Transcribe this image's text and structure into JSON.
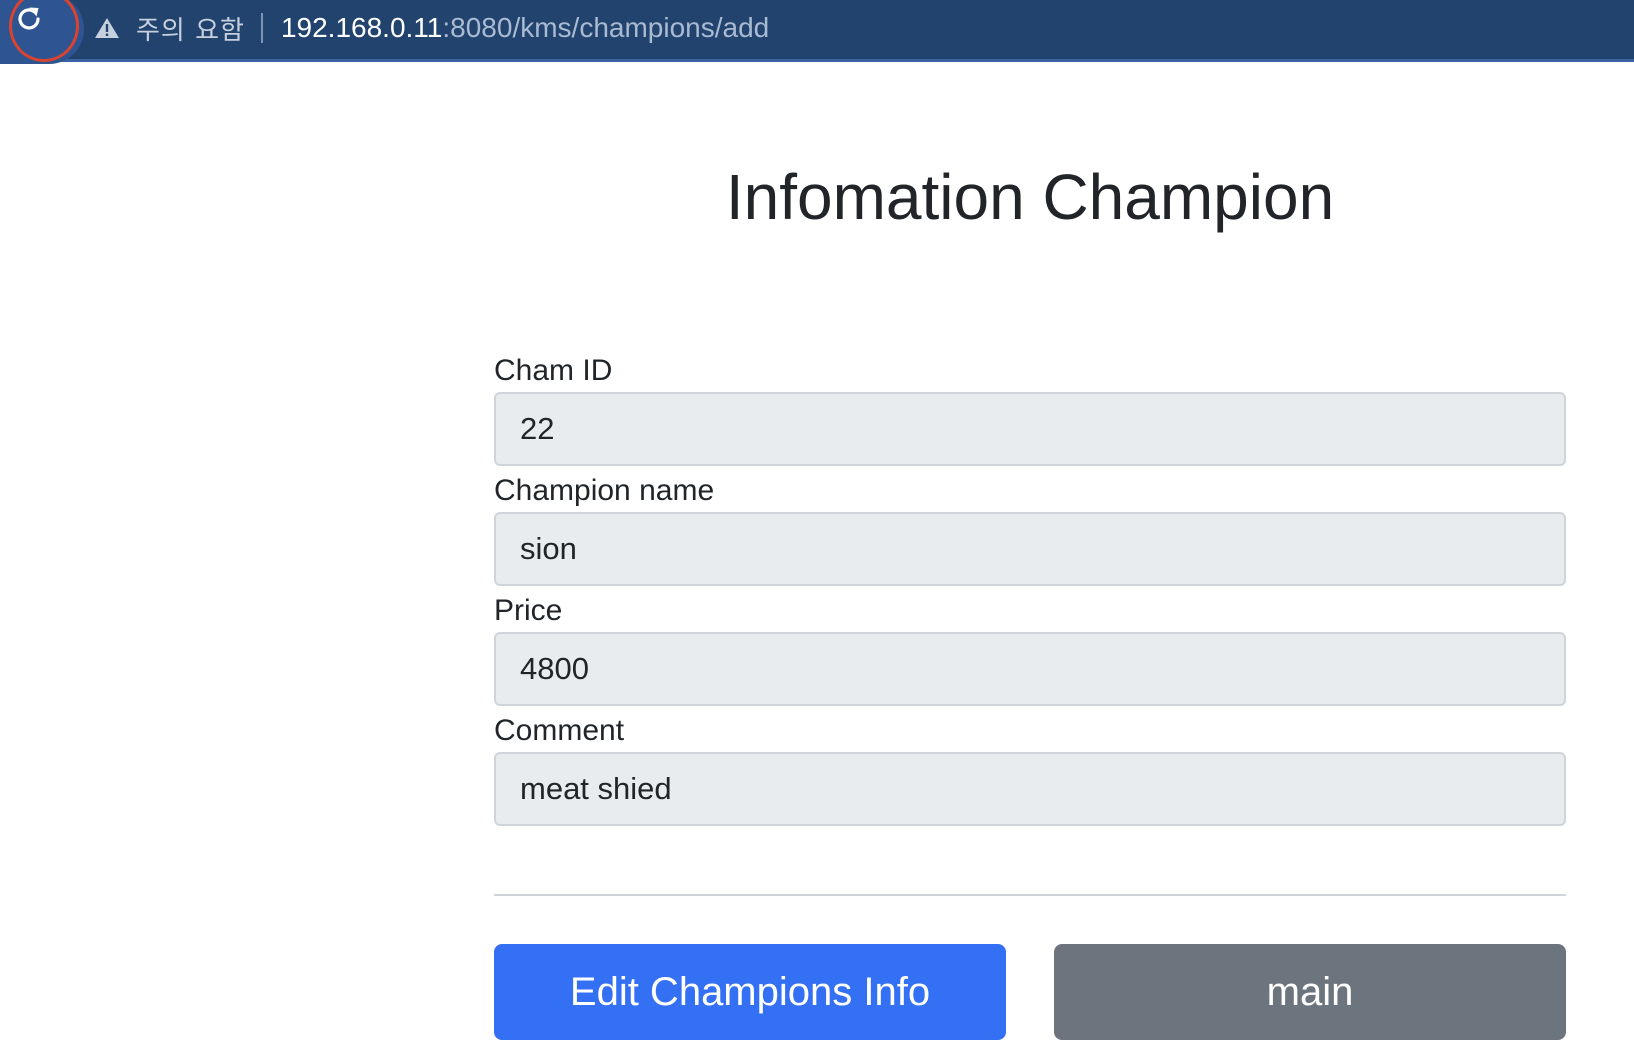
{
  "browser": {
    "security_warning": "주의 요함",
    "url_host": "192.168.0.11",
    "url_path": ":8080/kms/champions/add"
  },
  "page": {
    "title": "Infomation Champion"
  },
  "form": {
    "fields": [
      {
        "label": "Cham ID",
        "value": "22"
      },
      {
        "label": "Champion name",
        "value": "sion"
      },
      {
        "label": "Price",
        "value": "4800"
      },
      {
        "label": "Comment",
        "value": "meat shied"
      }
    ]
  },
  "buttons": {
    "edit_label": "Edit Champions Info",
    "main_label": "main"
  },
  "colors": {
    "browser_bar": "#22436e",
    "primary": "#3470f4",
    "secondary": "#6c757d",
    "annotation": "#d9432f"
  }
}
